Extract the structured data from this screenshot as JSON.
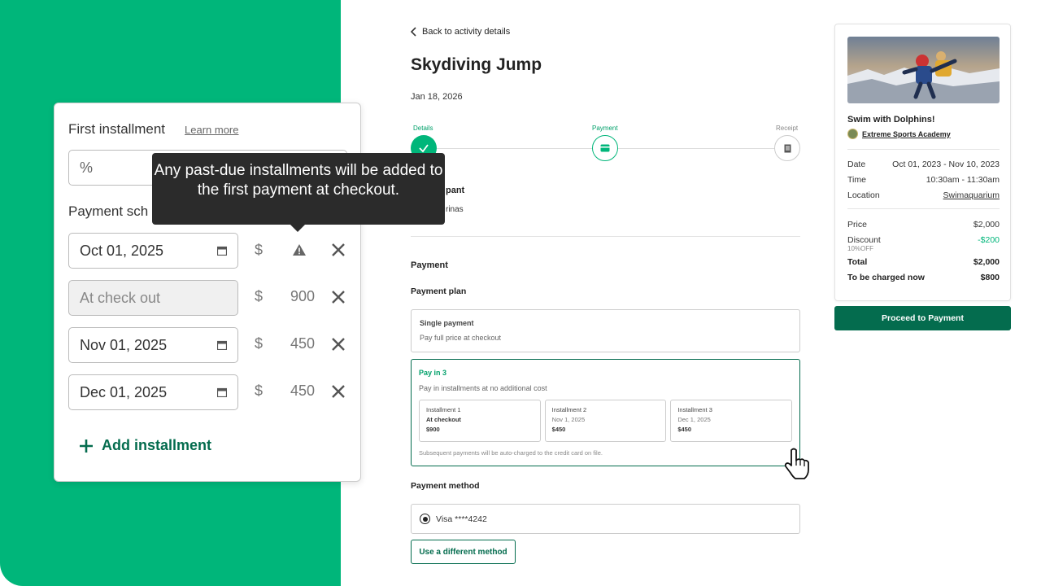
{
  "main": {
    "back_label": "Back to activity details",
    "title": "Skydiving Jump",
    "date": "Jan 18, 2026",
    "steps": [
      {
        "label": "Details"
      },
      {
        "label": "Payment"
      },
      {
        "label": "Receipt"
      }
    ],
    "participant_heading": "pant",
    "participant_name": "rinas",
    "payment_heading": "Payment",
    "payment_plan_heading": "Payment plan",
    "single": {
      "title": "Single payment",
      "desc": "Pay full price at checkout"
    },
    "pay3": {
      "title": "Pay in 3",
      "desc": "Pay in installments at no additional cost",
      "installments": [
        {
          "title": "Installment 1",
          "date": "At checkout",
          "amount": "$900"
        },
        {
          "title": "Installment 2",
          "date": "Nov 1, 2025",
          "amount": "$450"
        },
        {
          "title": "Installment 3",
          "date": "Dec 1, 2025",
          "amount": "$450"
        }
      ],
      "note": "Subsequent payments will be auto-charged to the credit card on file."
    },
    "payment_method_heading": "Payment method",
    "card_label": "Visa ****4242",
    "different_method_label": "Use a different method"
  },
  "summary": {
    "activity": "Swim with Dolphins!",
    "provider": "Extreme Sports Academy",
    "rows": [
      {
        "label": "Date",
        "value": "Oct 01, 2023 - Nov 10, 2023"
      },
      {
        "label": "Time",
        "value": "10:30am - 11:30am"
      },
      {
        "label": "Location",
        "value": "Swimaquarium"
      }
    ],
    "price_label": "Price",
    "price": "$2,000",
    "discount_label": "Discount",
    "discount": "-$200",
    "discount_note": "10%OFF",
    "total_label": "Total",
    "total": "$2,000",
    "charged_label": "To be charged now",
    "charged": "$800",
    "proceed_label": "Proceed to Payment"
  },
  "panel": {
    "first_installment_label": "First installment",
    "learn_more": "Learn more",
    "percent_placeholder": "%",
    "schedule_label": "Payment sch",
    "rows": [
      {
        "date": "Oct 01, 2025",
        "currency": "$",
        "amount": ""
      },
      {
        "date": "At check out",
        "currency": "$",
        "amount": "900"
      },
      {
        "date": "Nov 01, 2025",
        "currency": "$",
        "amount": "450"
      },
      {
        "date": "Dec 01, 2025",
        "currency": "$",
        "amount": "450"
      }
    ],
    "add_label": "Add installment",
    "tooltip": "Any past-due installments will be added to the first payment at checkout."
  },
  "colors": {
    "brand": "#00b67a",
    "dark_green": "#046c4e",
    "accent_text": "#00a06a"
  }
}
